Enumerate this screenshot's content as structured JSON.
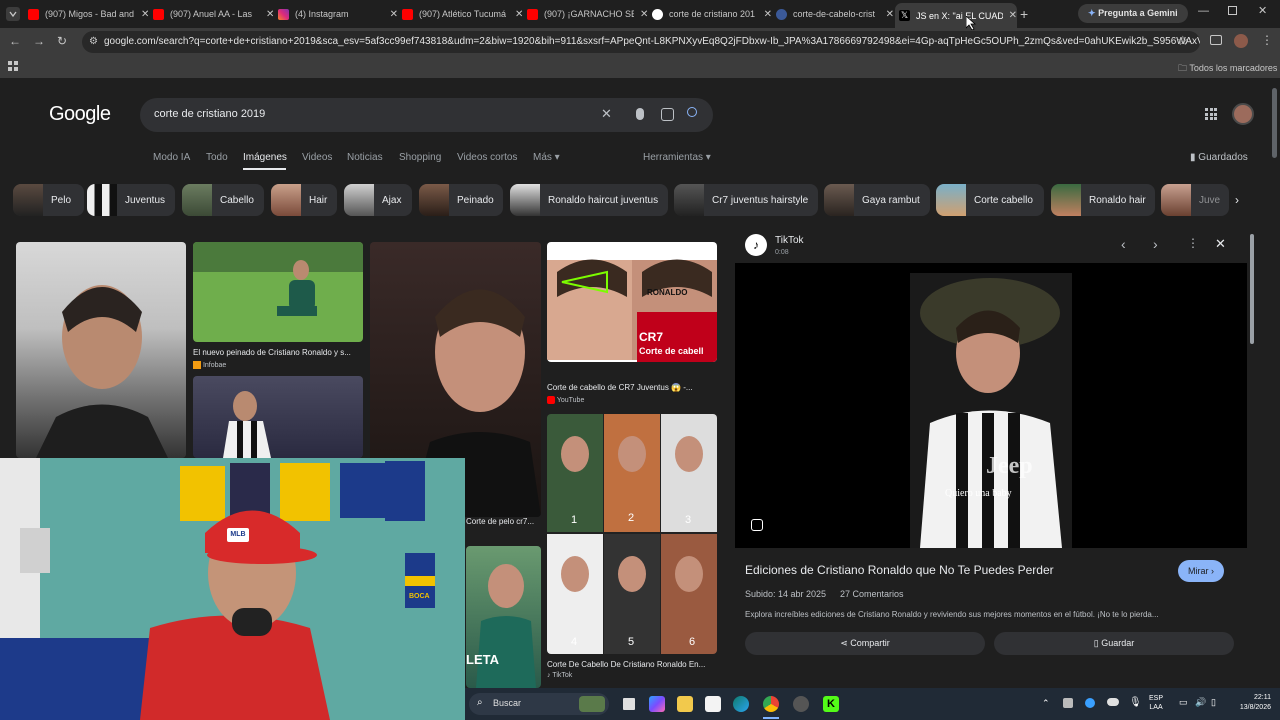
{
  "browser": {
    "tabs": [
      {
        "title": "(907) Migos - Bad and",
        "color": "#ff0000"
      },
      {
        "title": "(907) Anuel AA - Las",
        "color": "#ff0000"
      },
      {
        "title": "(4) Instagram",
        "color": "#e1306c"
      },
      {
        "title": "(907) Atlético Tucumá",
        "color": "#ff0000"
      },
      {
        "title": "(907) ¡GARNACHO SE",
        "color": "#ff0000"
      },
      {
        "title": "corte de cristiano 201",
        "color": "#4285f4"
      },
      {
        "title": "corte-de-cabelo-crist",
        "color": "#3b5998"
      },
      {
        "title": "JS en X: \"ai EL CUAD",
        "color": "#000000"
      }
    ],
    "gemini_label": "Pregunta a Gemini",
    "url": "google.com/search?q=corte+de+cristiano+2019&sca_esv=5af3cc99ef743818&udm=2&biw=1920&bih=911&sxsrf=APpeQnt-L8KPNXyvEq8Q2jFDbxw-Ib_JPA%3A1786669792498&ei=4Gp-aqTpHeGc5OUPh_2zmQs&ved=0ahUKEwik2b_S956WAxVhDrkGHYf-...",
    "bookmarks_label": "Todos los marcadores"
  },
  "google": {
    "logo": "Google",
    "query": "corte de cristiano 2019",
    "filters": [
      "Modo IA",
      "Todo",
      "Imágenes",
      "Videos",
      "Noticias",
      "Shopping",
      "Videos cortos",
      "Más"
    ],
    "tools_label": "Herramientas",
    "saved_label": "Guardados",
    "chips": [
      "Pelo",
      "Juventus",
      "Cabello",
      "Hair",
      "Ajax",
      "Peinado",
      "Ronaldo haircut juventus",
      "Cr7 juventus hairstyle",
      "Gaya rambut",
      "Corte cabello",
      "Ronaldo hair",
      "Juve"
    ]
  },
  "results": {
    "r1_caption": "El nuevo peinado de Cristiano Ronaldo y s...",
    "r1_source": "Infobae",
    "r2_caption": "Corte de cabello de CR7 Juventus 😱 -...",
    "r2_source": "YouTube",
    "r2_text_a": "CR7",
    "r2_text_b": "Corte de cabell",
    "r2_text_c": "RONALDO",
    "r3_caption": "Corte de pelo cr7...",
    "r4_caption": "Corte De Cabello De Cristiano Ronaldo En...",
    "r4_source": "TikTok",
    "grid_numbers": [
      "1",
      "2",
      "3",
      "4",
      "5",
      "6"
    ],
    "leta_text": "LETA"
  },
  "preview": {
    "source": "TikTok",
    "duration": "0:08",
    "overlay_text": "Quiero una baby",
    "jeep_text": "Jeep",
    "title": "Ediciones de Cristiano Ronaldo que No Te Puedes Perder",
    "watch_label": "Mirar",
    "uploaded": "Subido: 14 abr 2025",
    "comments": "27 Comentarios",
    "description": "Explora increíbles ediciones de Cristiano Ronaldo y reviviendo sus mejores momentos en el fútbol. ¡No te lo pierda...",
    "share_label": "Compartir",
    "save_label": "Guardar"
  },
  "webcam": {
    "cap_logo": "MLB",
    "banner_text": "BOCA"
  },
  "taskbar": {
    "search_placeholder": "Buscar",
    "lang_top": "ESP",
    "lang_bottom": "LAA",
    "time": "22:11",
    "date": "13/8/2026"
  }
}
